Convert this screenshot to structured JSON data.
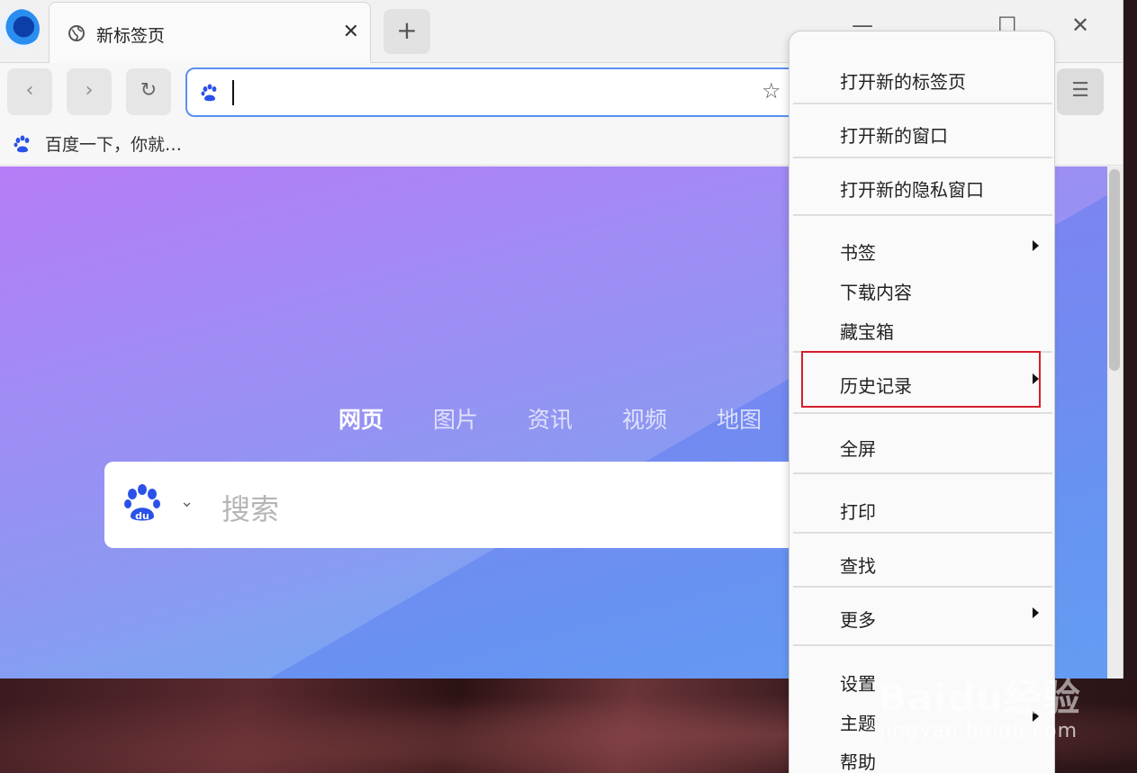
{
  "colors": {
    "accent": "#5b8ff0",
    "highlight_box": "#d31f2b",
    "baidu_blue": "#2a52e8"
  },
  "tabstrip": {
    "tabs": [
      {
        "title": "新标签页",
        "icon": "globe-icon",
        "close_glyph": "✕"
      }
    ],
    "new_tab_glyph": "+",
    "window_controls": {
      "minimize": "—",
      "maximize": "☐",
      "close": "✕"
    }
  },
  "toolbar": {
    "back_glyph": "‹",
    "forward_glyph": "›",
    "reload_glyph": "↻",
    "address_value": "",
    "star_glyph": "☆",
    "menu_glyph": "☰"
  },
  "bookmarks": [
    {
      "label": "百度一下，你就…",
      "icon": "baidu-paw-icon"
    }
  ],
  "page": {
    "search_tabs": [
      {
        "label": "网页",
        "active": true
      },
      {
        "label": "图片",
        "active": false
      },
      {
        "label": "资讯",
        "active": false
      },
      {
        "label": "视频",
        "active": false
      },
      {
        "label": "地图",
        "active": false
      }
    ],
    "search_placeholder": "搜索",
    "engine_chevron": "⌄"
  },
  "menu": {
    "items": [
      {
        "label": "打开新的标签页",
        "submenu": false
      },
      {
        "label": "打开新的窗口",
        "submenu": false
      },
      {
        "label": "打开新的隐私窗口",
        "submenu": false
      },
      {
        "label": "书签",
        "submenu": true
      },
      {
        "label": "下载内容",
        "submenu": false
      },
      {
        "label": "藏宝箱",
        "submenu": false
      },
      {
        "label": "历史记录",
        "submenu": true,
        "highlighted": true
      },
      {
        "label": "全屏",
        "submenu": false
      },
      {
        "label": "打印",
        "submenu": false
      },
      {
        "label": "查找",
        "submenu": false
      },
      {
        "label": "更多",
        "submenu": true
      },
      {
        "label": "设置",
        "submenu": false
      },
      {
        "label": "主题",
        "submenu": true
      },
      {
        "label": "帮助",
        "submenu": false
      }
    ]
  },
  "watermark": {
    "brand": "Baidu经验",
    "site": "jingyan.baidu.com"
  }
}
